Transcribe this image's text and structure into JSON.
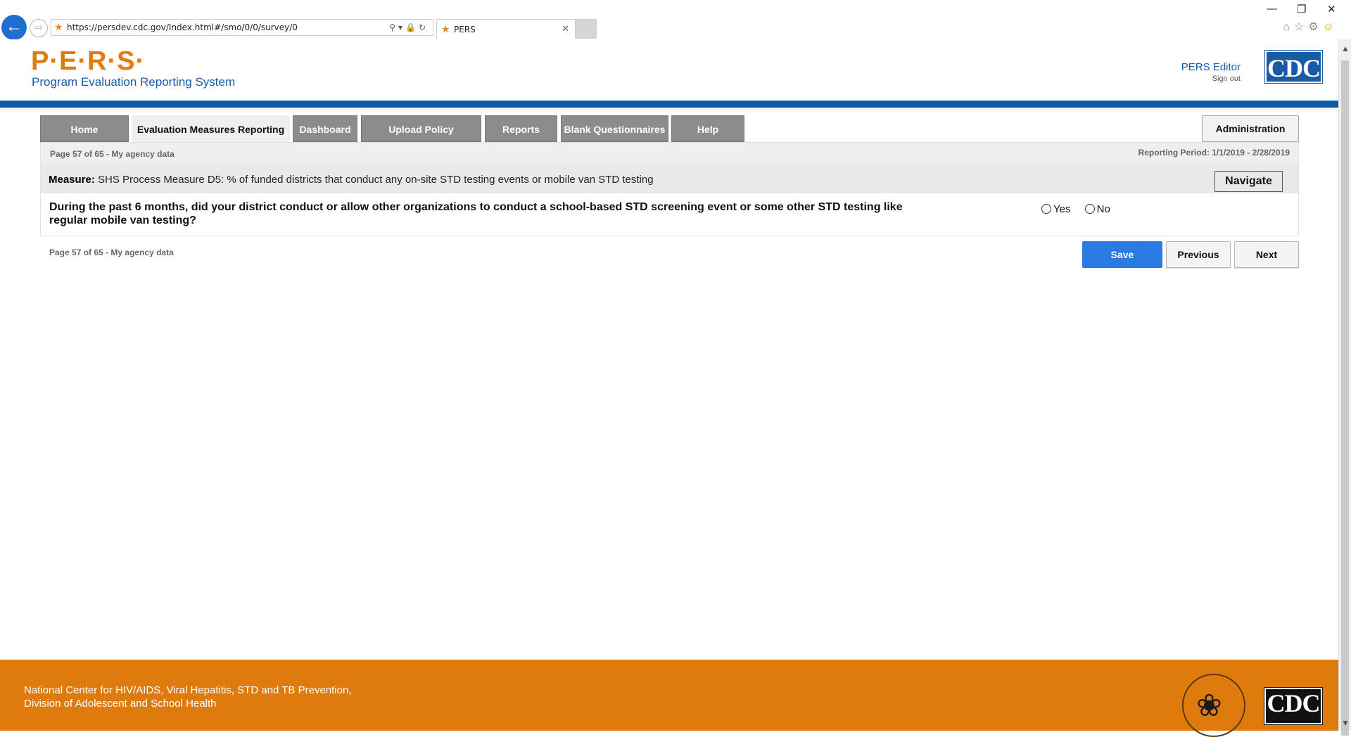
{
  "browser": {
    "url": "https://persdev.cdc.gov/Index.html#/smo/0/0/survey/0",
    "tab_title": "PERS"
  },
  "header": {
    "logo_text": "P·E·R·S·",
    "subtitle": "Program Evaluation Reporting System",
    "user_name": "PERS Editor",
    "sign_out": "Sign out",
    "cdc_logo": "CDC"
  },
  "nav": {
    "items": [
      {
        "label": "Home"
      },
      {
        "label": "Evaluation Measures Reporting"
      },
      {
        "label": "Dashboard"
      },
      {
        "label": "Upload Policy Documents"
      },
      {
        "label": "Reports"
      },
      {
        "label": "Blank Questionnaires"
      },
      {
        "label": "Help"
      }
    ],
    "active_index": 1,
    "admin_label": "Administration"
  },
  "survey": {
    "page_label": "Page 57 of 65",
    "agency_label": "My agency data",
    "reporting_period": "Reporting Period: 1/1/2019 - 2/28/2019",
    "measure_label": "Measure:",
    "measure_text": "SHS Process Measure D5: % of funded districts that conduct any on-site STD testing events or mobile van STD testing",
    "navigate_label": "Navigate",
    "question": "During the past 6 months, did your district conduct or allow other organizations to conduct a school-based STD screening event or some other STD testing like regular mobile van testing?",
    "options": [
      {
        "label": "Yes",
        "selected": false
      },
      {
        "label": "No",
        "selected": false
      }
    ]
  },
  "actions": {
    "save_label": "Save",
    "previous_label": "Previous",
    "next_label": "Next"
  },
  "footer": {
    "line1": "National Center for HIV/AIDS, Viral Hepatitis, STD and TB Prevention,",
    "line2": "Division of Adolescent and School Health",
    "cdc_logo": "CDC"
  },
  "colors": {
    "brand_orange": "#df7b0d",
    "brand_blue": "#0f5aa8",
    "save_blue": "#2a7ae2",
    "nav_gray": "#8c8c8c"
  }
}
